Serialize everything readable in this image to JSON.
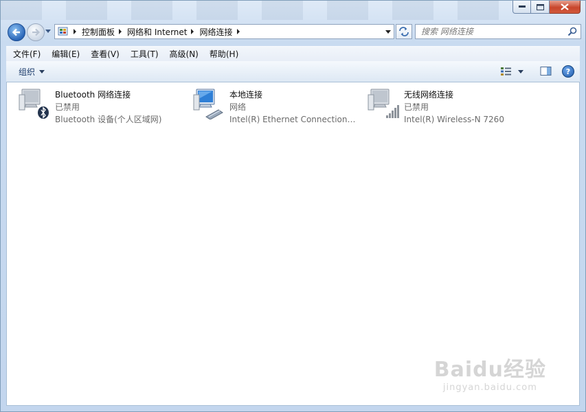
{
  "breadcrumbs": [
    "控制面板",
    "网络和 Internet",
    "网络连接"
  ],
  "search": {
    "placeholder": "搜索 网络连接"
  },
  "menu": [
    "文件(F)",
    "编辑(E)",
    "查看(V)",
    "工具(T)",
    "高级(N)",
    "帮助(H)"
  ],
  "command_bar": {
    "organize": "组织"
  },
  "connections": [
    {
      "name": "Bluetooth 网络连接",
      "status": "已禁用",
      "device": "Bluetooth 设备(个人区域网)",
      "icon": "bluetooth-network-icon"
    },
    {
      "name": "本地连接",
      "status": "网络",
      "device": "Intel(R) Ethernet Connection I2...",
      "icon": "ethernet-network-icon"
    },
    {
      "name": "无线网络连接",
      "status": "已禁用",
      "device": "Intel(R) Wireless-N 7260",
      "icon": "wireless-network-icon"
    }
  ],
  "watermark": {
    "main": "Baidu经验",
    "sub": "jingyan.baidu.com"
  },
  "colors": {
    "accent": "#2a66b8",
    "close": "#c8462c"
  }
}
